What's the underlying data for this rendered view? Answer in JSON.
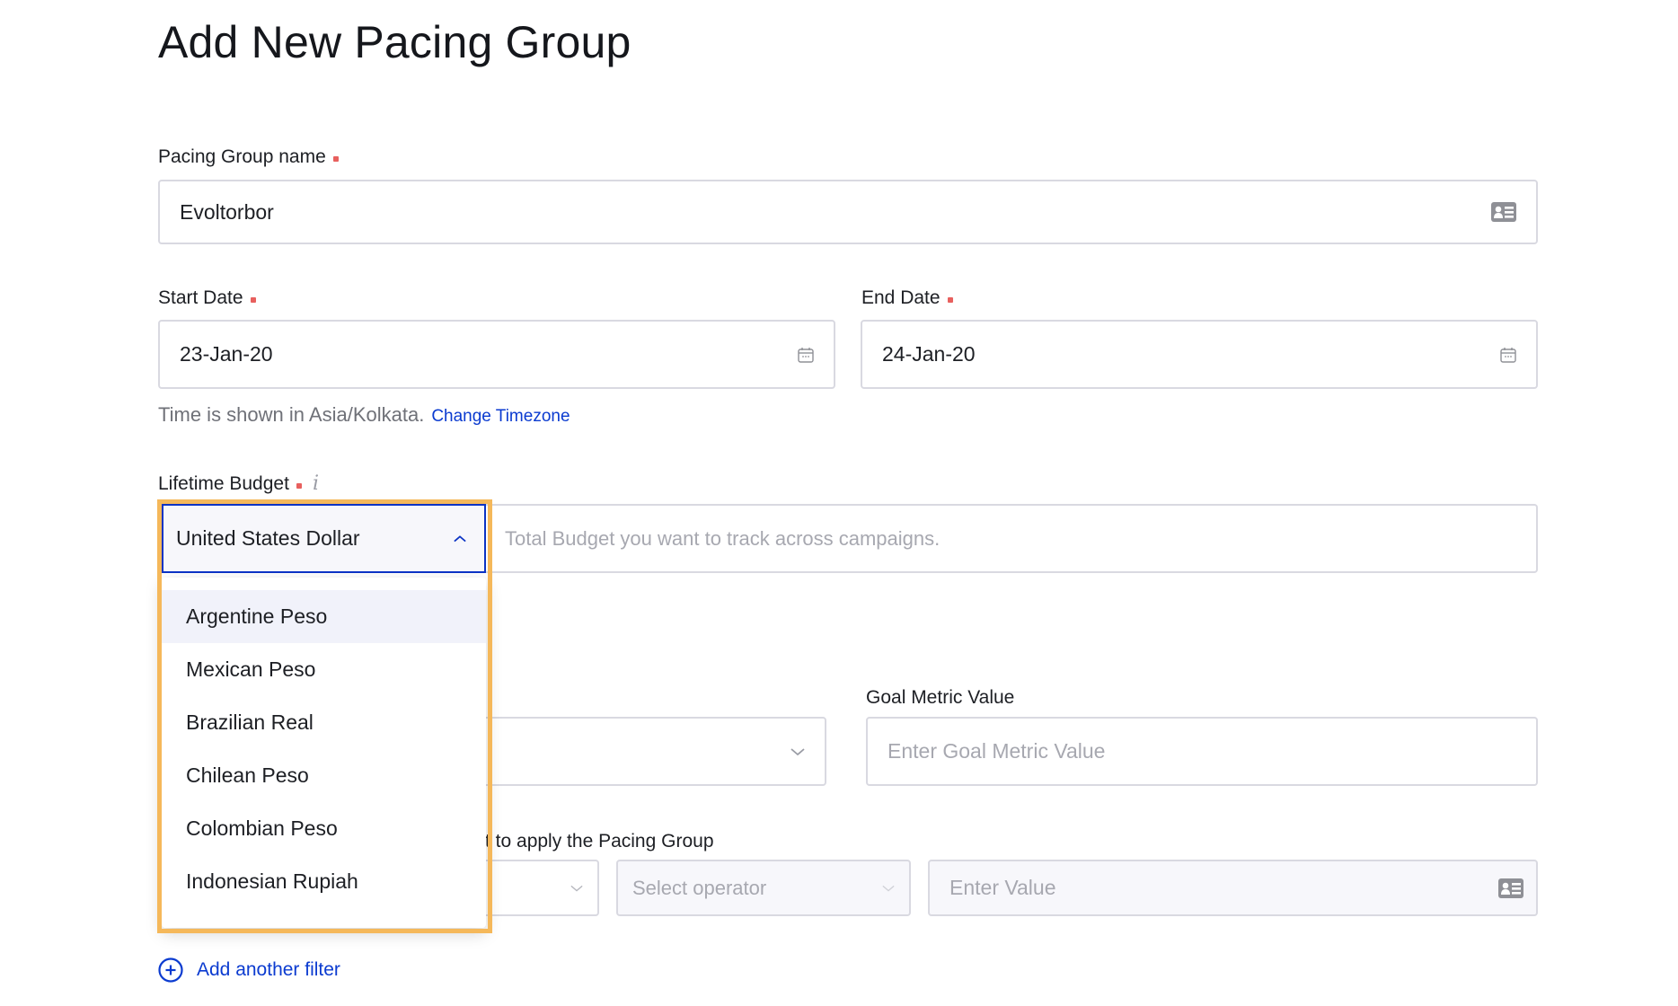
{
  "page": {
    "title": "Add New Pacing Group"
  },
  "pacing_group_name": {
    "label": "Pacing Group name",
    "value": "Evoltorbor",
    "icon": "contact-card-icon"
  },
  "start_date": {
    "label": "Start Date",
    "value": "23-Jan-20",
    "icon": "calendar-icon"
  },
  "end_date": {
    "label": "End Date",
    "value": "24-Jan-20",
    "icon": "calendar-icon"
  },
  "timezone": {
    "text": "Time is shown in Asia/Kolkata.",
    "link": "Change Timezone"
  },
  "lifetime_budget": {
    "label": "Lifetime Budget",
    "info_icon": "i",
    "currency_selected": "United States Dollar",
    "amount_placeholder": "Total Budget you want to track across campaigns.",
    "currency_options": [
      "Argentine Peso",
      "Mexican Peso",
      "Brazilian Real",
      "Chilean Peso",
      "Colombian Peso",
      "Indonesian Rupiah"
    ],
    "highlighted_option_index": 0
  },
  "goal_metric_value": {
    "label": "Goal Metric Value",
    "placeholder": "Enter Goal Metric Value"
  },
  "filter": {
    "label_visible_fragment": "t to apply the Pacing Group",
    "operator_placeholder": "Select operator",
    "value_placeholder": "Enter Value"
  },
  "add_filter": {
    "label": "Add another filter"
  },
  "colors": {
    "link": "#0b3bd0",
    "required": "#e8605e",
    "highlight": "#f5b85a",
    "focus_border": "#0b33c4"
  }
}
